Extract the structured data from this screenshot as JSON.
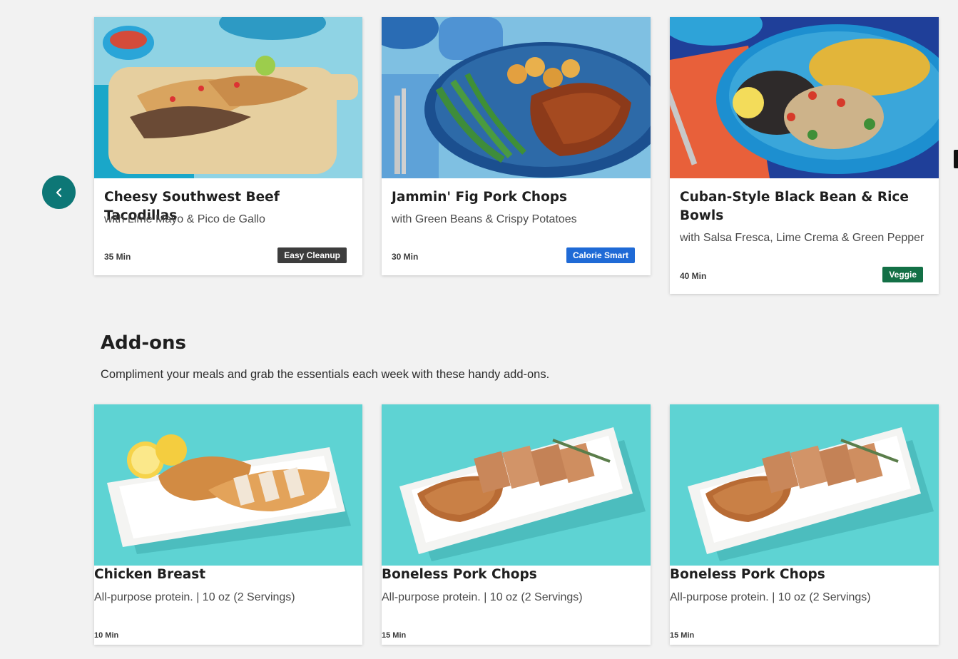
{
  "meals": [
    {
      "title": "Cheesy Southwest Beef Tacodillas",
      "subtitle": "with Lime Mayo & Pico de Gallo",
      "time": "35 Min",
      "badge": "Easy Cleanup",
      "badge_color": "#3d3d3d"
    },
    {
      "title": "Jammin' Fig Pork Chops",
      "subtitle": "with Green Beans & Crispy Potatoes",
      "time": "30 Min",
      "badge": "Calorie Smart",
      "badge_color": "#1f6ad6"
    },
    {
      "title": "Cuban-Style Black Bean & Rice Bowls",
      "subtitle": "with Salsa Fresca, Lime Crema & Green Pepper",
      "time": "40 Min",
      "badge": "Veggie",
      "badge_color": "#137046"
    }
  ],
  "carousel": {
    "prev_icon": "chevron-left-icon",
    "button_color": "#0d7776"
  },
  "addons_section": {
    "title": "Add-ons",
    "description": "Compliment your meals and grab the essentials each week with these handy add-ons."
  },
  "addons": [
    {
      "title": "Chicken Breast",
      "subtitle": "All-purpose protein. | 10 oz (2 Servings)",
      "time": "10 Min"
    },
    {
      "title": "Boneless Pork Chops",
      "subtitle": "All-purpose protein. | 10 oz (2 Servings)",
      "time": "15 Min"
    },
    {
      "title": "Boneless Pork Chops",
      "subtitle": "All-purpose protein. | 10 oz (2 Servings)",
      "time": "15 Min"
    }
  ]
}
